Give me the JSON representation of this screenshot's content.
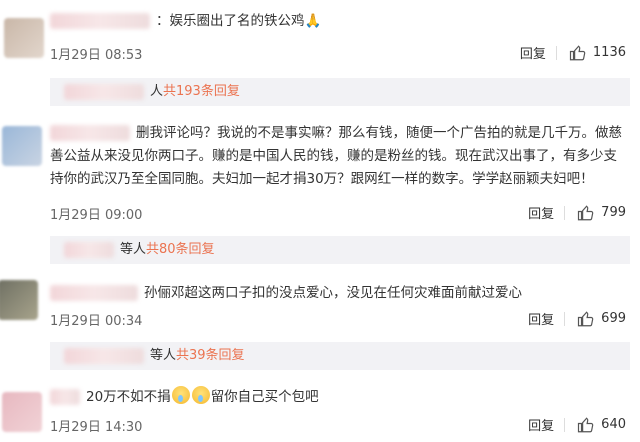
{
  "comments": [
    {
      "text": "：娱乐圈出了名的铁公鸡",
      "emoji": "🙏",
      "date": "1月29日 08:53",
      "reply_label": "回复",
      "likes": "1136",
      "replies_who": "人",
      "replies_count": "共193条回复"
    },
    {
      "text": "删我评论吗？我说的不是事实嘛？那么有钱，随便一个广告拍的就是几千万。做慈善公益从来没见你两口子。赚的是中国人民的钱，赚的是粉丝的钱。现在武汉出事了，有多少支持你的武汉乃至全国同胞。夫妇加一起才捐30万？跟网红一样的数字。学学赵丽颖夫妇吧！",
      "date": "1月29日 09:00",
      "reply_label": "回复",
      "likes": "799",
      "replies_who": "等人",
      "replies_count": "共80条回复"
    },
    {
      "text": "孙俪邓超这两口子扣的没点爱心，没见在任何灾难面前献过爱心",
      "date": "1月29日 00:34",
      "reply_label": "回复",
      "likes": "699",
      "replies_who": "等人",
      "replies_count": "共39条回复"
    },
    {
      "text_a": "20万不如不捐",
      "text_b": "留你自己买个包吧",
      "date": "1月29日 14:30",
      "reply_label": "回复",
      "likes": "640"
    }
  ]
}
